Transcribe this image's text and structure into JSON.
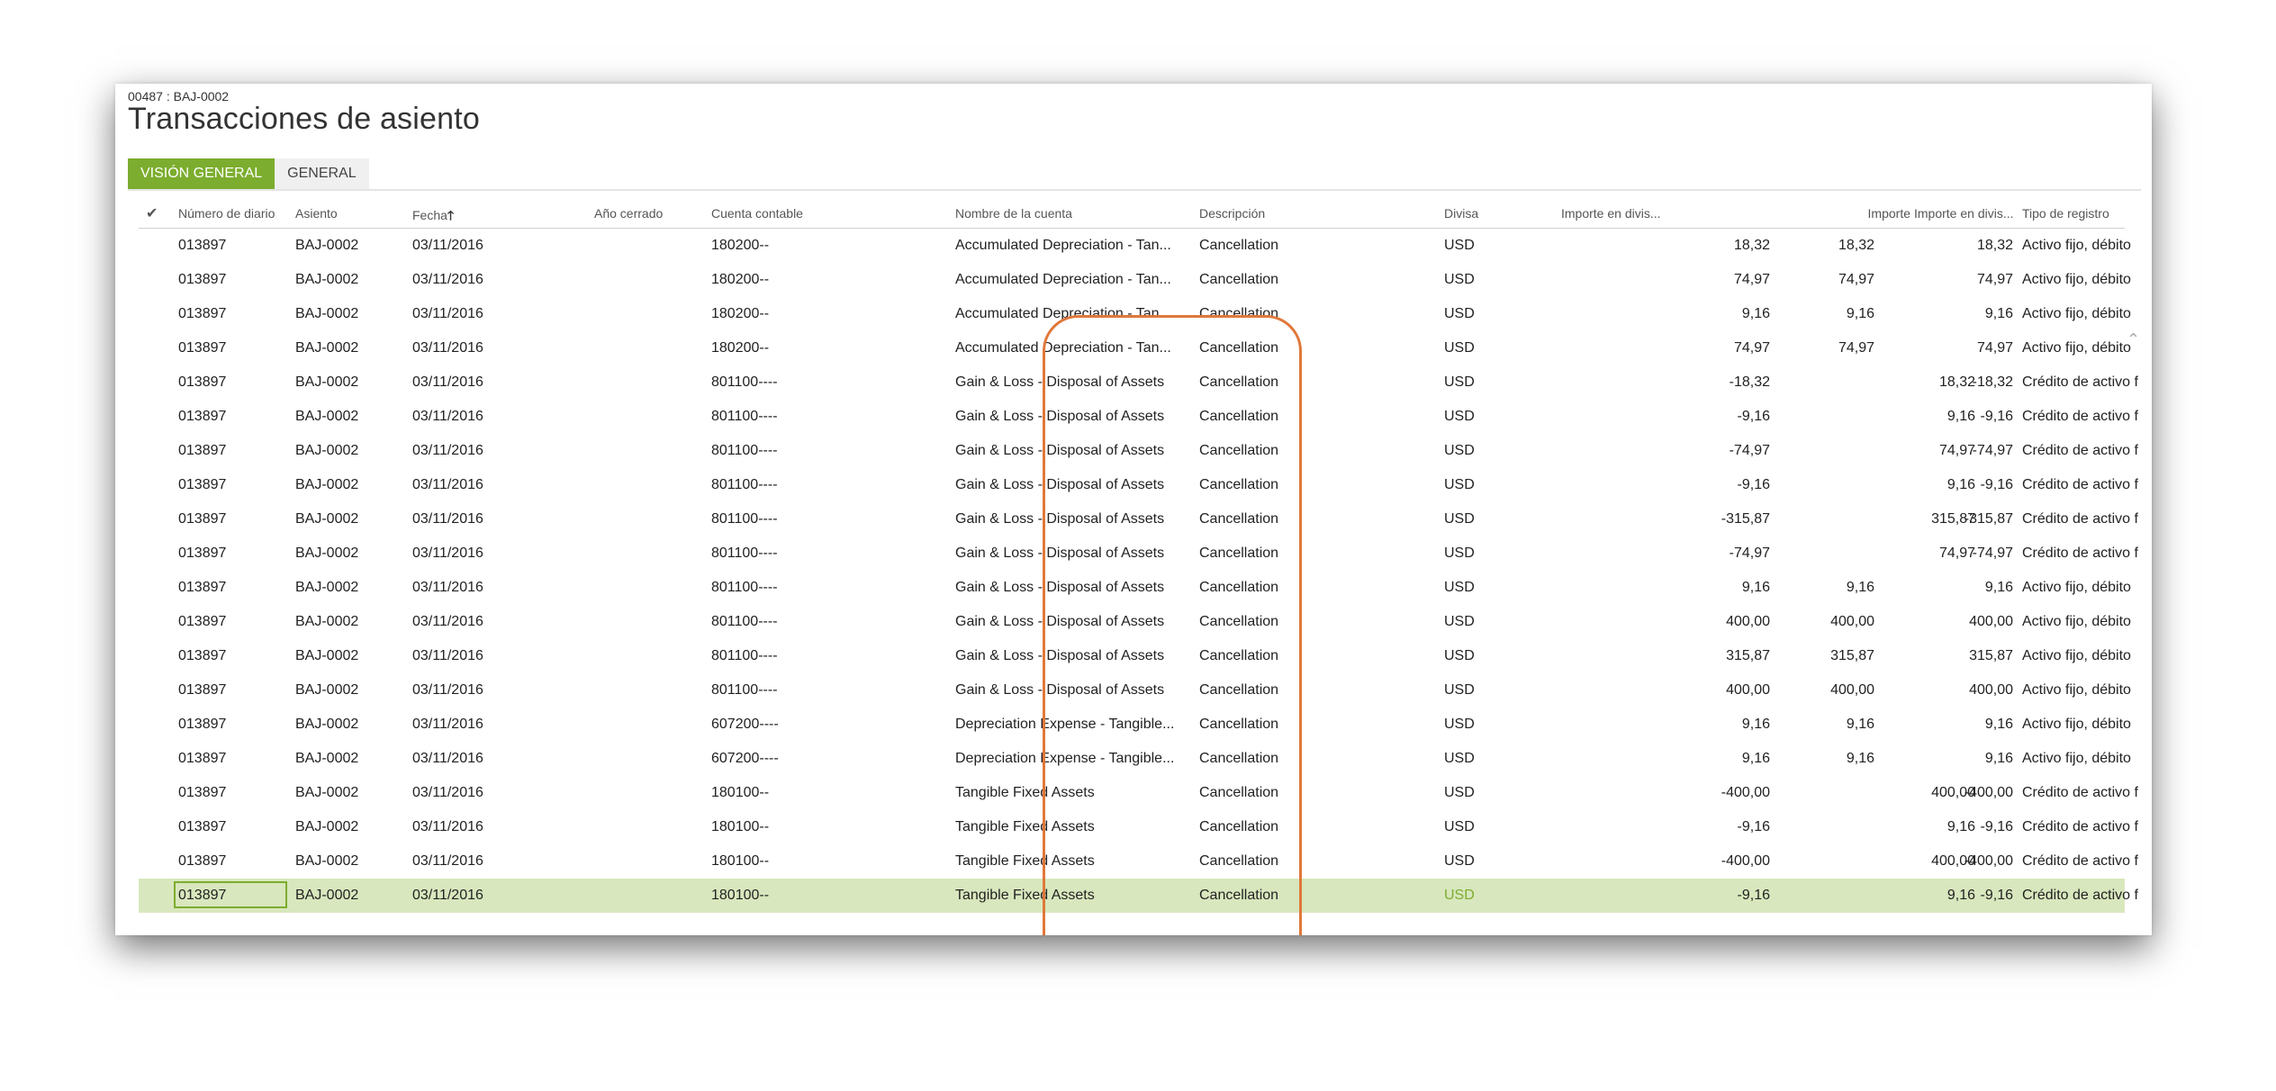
{
  "header": {
    "breadcrumb": "00487 : BAJ-0002",
    "title": "Transacciones de asiento"
  },
  "tabs": [
    {
      "label": "VISIÓN GENERAL",
      "active": true
    },
    {
      "label": "GENERAL",
      "active": false
    }
  ],
  "columns": {
    "select": "✔",
    "journal": "Número de diario",
    "voucher": "Asiento",
    "date": "Fecha",
    "year_closed": "Año cerrado",
    "account": "Cuenta contable",
    "account_name": "Nombre de la cuenta",
    "description": "Descripción",
    "currency": "Divisa",
    "amount_cur": "Importe en divis...",
    "amount": "Importe",
    "amount_cur2": "Importe en divis...",
    "type": "Tipo de registro"
  },
  "sort_icon": "arrow-up-icon",
  "accent_color": "#7cad2e",
  "highlight_color": "#e0783a",
  "rows": [
    {
      "journal": "013897",
      "voucher": "BAJ-0002",
      "date": "03/11/2016",
      "year_closed": "",
      "account": "180200--",
      "account_name": "Accumulated Depreciation - Tan...",
      "description": "Cancellation",
      "currency": "USD",
      "amount_cur": "18,32",
      "debit": "18,32",
      "credit": "",
      "amount": "18,32",
      "type": "Activo fijo, débito"
    },
    {
      "journal": "013897",
      "voucher": "BAJ-0002",
      "date": "03/11/2016",
      "year_closed": "",
      "account": "180200--",
      "account_name": "Accumulated Depreciation - Tan...",
      "description": "Cancellation",
      "currency": "USD",
      "amount_cur": "74,97",
      "debit": "74,97",
      "credit": "",
      "amount": "74,97",
      "type": "Activo fijo, débito"
    },
    {
      "journal": "013897",
      "voucher": "BAJ-0002",
      "date": "03/11/2016",
      "year_closed": "",
      "account": "180200--",
      "account_name": "Accumulated Depreciation - Tan...",
      "description": "Cancellation",
      "currency": "USD",
      "amount_cur": "9,16",
      "debit": "9,16",
      "credit": "",
      "amount": "9,16",
      "type": "Activo fijo, débito"
    },
    {
      "journal": "013897",
      "voucher": "BAJ-0002",
      "date": "03/11/2016",
      "year_closed": "",
      "account": "180200--",
      "account_name": "Accumulated Depreciation - Tan...",
      "description": "Cancellation",
      "currency": "USD",
      "amount_cur": "74,97",
      "debit": "74,97",
      "credit": "",
      "amount": "74,97",
      "type": "Activo fijo, débito"
    },
    {
      "journal": "013897",
      "voucher": "BAJ-0002",
      "date": "03/11/2016",
      "year_closed": "",
      "account": "801100----",
      "account_name": "Gain & Loss - Disposal of Assets",
      "description": "Cancellation",
      "currency": "USD",
      "amount_cur": "-18,32",
      "debit": "",
      "credit": "18,32",
      "amount": "-18,32",
      "type": "Crédito de activo f"
    },
    {
      "journal": "013897",
      "voucher": "BAJ-0002",
      "date": "03/11/2016",
      "year_closed": "",
      "account": "801100----",
      "account_name": "Gain & Loss - Disposal of Assets",
      "description": "Cancellation",
      "currency": "USD",
      "amount_cur": "-9,16",
      "debit": "",
      "credit": "9,16",
      "amount": "-9,16",
      "type": "Crédito de activo f"
    },
    {
      "journal": "013897",
      "voucher": "BAJ-0002",
      "date": "03/11/2016",
      "year_closed": "",
      "account": "801100----",
      "account_name": "Gain & Loss - Disposal of Assets",
      "description": "Cancellation",
      "currency": "USD",
      "amount_cur": "-74,97",
      "debit": "",
      "credit": "74,97",
      "amount": "-74,97",
      "type": "Crédito de activo f"
    },
    {
      "journal": "013897",
      "voucher": "BAJ-0002",
      "date": "03/11/2016",
      "year_closed": "",
      "account": "801100----",
      "account_name": "Gain & Loss - Disposal of Assets",
      "description": "Cancellation",
      "currency": "USD",
      "amount_cur": "-9,16",
      "debit": "",
      "credit": "9,16",
      "amount": "-9,16",
      "type": "Crédito de activo f"
    },
    {
      "journal": "013897",
      "voucher": "BAJ-0002",
      "date": "03/11/2016",
      "year_closed": "",
      "account": "801100----",
      "account_name": "Gain & Loss - Disposal of Assets",
      "description": "Cancellation",
      "currency": "USD",
      "amount_cur": "-315,87",
      "debit": "",
      "credit": "315,87",
      "amount": "-315,87",
      "type": "Crédito de activo f"
    },
    {
      "journal": "013897",
      "voucher": "BAJ-0002",
      "date": "03/11/2016",
      "year_closed": "",
      "account": "801100----",
      "account_name": "Gain & Loss - Disposal of Assets",
      "description": "Cancellation",
      "currency": "USD",
      "amount_cur": "-74,97",
      "debit": "",
      "credit": "74,97",
      "amount": "-74,97",
      "type": "Crédito de activo f"
    },
    {
      "journal": "013897",
      "voucher": "BAJ-0002",
      "date": "03/11/2016",
      "year_closed": "",
      "account": "801100----",
      "account_name": "Gain & Loss - Disposal of Assets",
      "description": "Cancellation",
      "currency": "USD",
      "amount_cur": "9,16",
      "debit": "9,16",
      "credit": "",
      "amount": "9,16",
      "type": "Activo fijo, débito"
    },
    {
      "journal": "013897",
      "voucher": "BAJ-0002",
      "date": "03/11/2016",
      "year_closed": "",
      "account": "801100----",
      "account_name": "Gain & Loss - Disposal of Assets",
      "description": "Cancellation",
      "currency": "USD",
      "amount_cur": "400,00",
      "debit": "400,00",
      "credit": "",
      "amount": "400,00",
      "type": "Activo fijo, débito"
    },
    {
      "journal": "013897",
      "voucher": "BAJ-0002",
      "date": "03/11/2016",
      "year_closed": "",
      "account": "801100----",
      "account_name": "Gain & Loss - Disposal of Assets",
      "description": "Cancellation",
      "currency": "USD",
      "amount_cur": "315,87",
      "debit": "315,87",
      "credit": "",
      "amount": "315,87",
      "type": "Activo fijo, débito"
    },
    {
      "journal": "013897",
      "voucher": "BAJ-0002",
      "date": "03/11/2016",
      "year_closed": "",
      "account": "801100----",
      "account_name": "Gain & Loss - Disposal of Assets",
      "description": "Cancellation",
      "currency": "USD",
      "amount_cur": "400,00",
      "debit": "400,00",
      "credit": "",
      "amount": "400,00",
      "type": "Activo fijo, débito"
    },
    {
      "journal": "013897",
      "voucher": "BAJ-0002",
      "date": "03/11/2016",
      "year_closed": "",
      "account": "607200----",
      "account_name": "Depreciation Expense - Tangible...",
      "description": "Cancellation",
      "currency": "USD",
      "amount_cur": "9,16",
      "debit": "9,16",
      "credit": "",
      "amount": "9,16",
      "type": "Activo fijo, débito"
    },
    {
      "journal": "013897",
      "voucher": "BAJ-0002",
      "date": "03/11/2016",
      "year_closed": "",
      "account": "607200----",
      "account_name": "Depreciation Expense - Tangible...",
      "description": "Cancellation",
      "currency": "USD",
      "amount_cur": "9,16",
      "debit": "9,16",
      "credit": "",
      "amount": "9,16",
      "type": "Activo fijo, débito"
    },
    {
      "journal": "013897",
      "voucher": "BAJ-0002",
      "date": "03/11/2016",
      "year_closed": "",
      "account": "180100--",
      "account_name": "Tangible Fixed Assets",
      "description": "Cancellation",
      "currency": "USD",
      "amount_cur": "-400,00",
      "debit": "",
      "credit": "400,00",
      "amount": "-400,00",
      "type": "Crédito de activo f"
    },
    {
      "journal": "013897",
      "voucher": "BAJ-0002",
      "date": "03/11/2016",
      "year_closed": "",
      "account": "180100--",
      "account_name": "Tangible Fixed Assets",
      "description": "Cancellation",
      "currency": "USD",
      "amount_cur": "-9,16",
      "debit": "",
      "credit": "9,16",
      "amount": "-9,16",
      "type": "Crédito de activo f"
    },
    {
      "journal": "013897",
      "voucher": "BAJ-0002",
      "date": "03/11/2016",
      "year_closed": "",
      "account": "180100--",
      "account_name": "Tangible Fixed Assets",
      "description": "Cancellation",
      "currency": "USD",
      "amount_cur": "-400,00",
      "debit": "",
      "credit": "400,00",
      "amount": "-400,00",
      "type": "Crédito de activo f"
    },
    {
      "journal": "013897",
      "voucher": "BAJ-0002",
      "date": "03/11/2016",
      "year_closed": "",
      "account": "180100--",
      "account_name": "Tangible Fixed Assets",
      "description": "Cancellation",
      "currency": "USD",
      "amount_cur": "-9,16",
      "debit": "",
      "credit": "9,16",
      "amount": "-9,16",
      "type": "Crédito de activo f",
      "selected": true
    }
  ]
}
